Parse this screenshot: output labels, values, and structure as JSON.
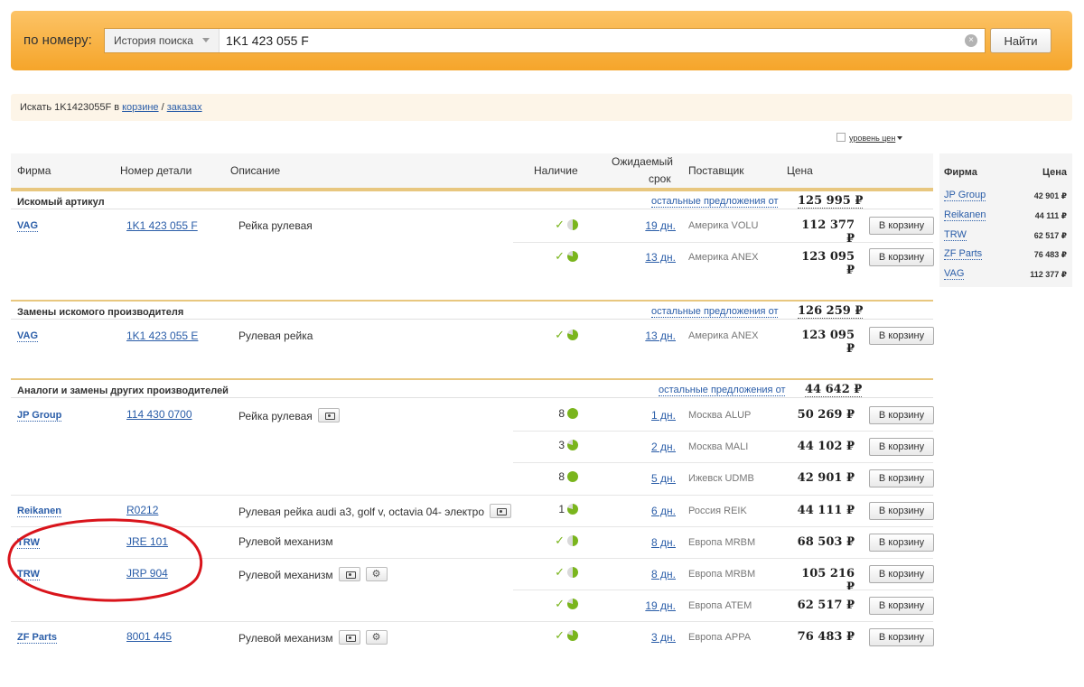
{
  "search": {
    "label": "по номеру:",
    "history": "История поиска",
    "value": "1K1 423 055 F",
    "clear_symbol": "×",
    "button": "Найти"
  },
  "info": {
    "prefix": "Искать 1K1423055F в ",
    "cart_link": "корзине",
    "separator": " / ",
    "orders_link": "заказах"
  },
  "price_level": "уровень цен",
  "headers": {
    "firm": "Фирма",
    "part": "Номер детали",
    "desc": "Описание",
    "avail": "Наличие",
    "term1": "Ожидаемый",
    "term2": "срок",
    "supplier": "Поставщик",
    "price": "Цена"
  },
  "sections": [
    {
      "title": "Искомый артикул",
      "others_label": "остальные предложения от",
      "others_price": "125 995 ₽"
    },
    {
      "title": "Замены искомого производителя",
      "others_label": "остальные предложения от",
      "others_price": "126 259 ₽"
    },
    {
      "title": "Аналоги и замены других производителей",
      "others_label": "остальные предложения от",
      "others_price": "44 642 ₽"
    }
  ],
  "cart_label": "В корзину",
  "rows": [
    {
      "firm": "VAG",
      "part": "1K1 423 055 F",
      "desc": "Рейка рулевая",
      "avail": "",
      "pie": "half",
      "days": "19 дн.",
      "supplier": "Америка VOLU",
      "price": "112 377 ₽"
    },
    {
      "firm": "",
      "part": "",
      "desc": "",
      "avail": "",
      "pie": "three",
      "days": "13 дн.",
      "supplier": "Америка ANEX",
      "price": "123 095 ₽"
    },
    {
      "firm": "VAG",
      "part": "1K1 423 055 E",
      "desc": "Рулевая рейка",
      "avail": "",
      "pie": "three",
      "days": "13 дн.",
      "supplier": "Америка ANEX",
      "price": "123 095 ₽"
    },
    {
      "firm": "JP Group",
      "part": "114 430 0700",
      "desc": "Рейка рулевая",
      "avail": "8",
      "pie": "full",
      "days": "1 дн.",
      "supplier": "Москва ALUP",
      "price": "50 269 ₽"
    },
    {
      "firm": "",
      "part": "",
      "desc": "",
      "avail": "3",
      "pie": "three",
      "days": "2 дн.",
      "supplier": "Москва MALI",
      "price": "44 102 ₽"
    },
    {
      "firm": "",
      "part": "",
      "desc": "",
      "avail": "8",
      "pie": "full",
      "days": "5 дн.",
      "supplier": "Ижевск UDMB",
      "price": "42 901 ₽"
    },
    {
      "firm": "Reikanen",
      "part": "R0212",
      "desc": "Рулевая рейка audi a3, golf v, octavia 04- электро",
      "avail": "1",
      "pie": "three",
      "days": "6 дн.",
      "supplier": "Россия REIK",
      "price": "44 111 ₽"
    },
    {
      "firm": "TRW",
      "part": "JRE 101",
      "desc": "Рулевой механизм",
      "avail": "",
      "pie": "half",
      "days": "8 дн.",
      "supplier": "Европа MRBM",
      "price": "68 503 ₽"
    },
    {
      "firm": "TRW",
      "part": "JRP 904",
      "desc": "Рулевой механизм",
      "avail": "",
      "pie": "half",
      "days": "8 дн.",
      "supplier": "Европа MRBM",
      "price": "105 216 ₽"
    },
    {
      "firm": "",
      "part": "",
      "desc": "",
      "avail": "",
      "pie": "three",
      "days": "19 дн.",
      "supplier": "Европа ATEM",
      "price": "62 517 ₽"
    },
    {
      "firm": "ZF Parts",
      "part": "8001 445",
      "desc": "Рулевой механизм",
      "avail": "",
      "pie": "three",
      "days": "3 дн.",
      "supplier": "Европа APPA",
      "price": "76 483 ₽"
    }
  ],
  "side": {
    "firm_header": "Фирма",
    "price_header": "Цена",
    "items": [
      {
        "firm": "JP Group",
        "price": "42 901 ₽"
      },
      {
        "firm": "Reikanen",
        "price": "44 111 ₽"
      },
      {
        "firm": "TRW",
        "price": "62 517 ₽"
      },
      {
        "firm": "ZF Parts",
        "price": "76 483 ₽"
      },
      {
        "firm": "VAG",
        "price": "112 377 ₽"
      }
    ]
  },
  "colors": {
    "accent": "#f5a52a",
    "link": "#2a5da8",
    "annotation": "#d9141b",
    "stock": "#7ab51d"
  }
}
